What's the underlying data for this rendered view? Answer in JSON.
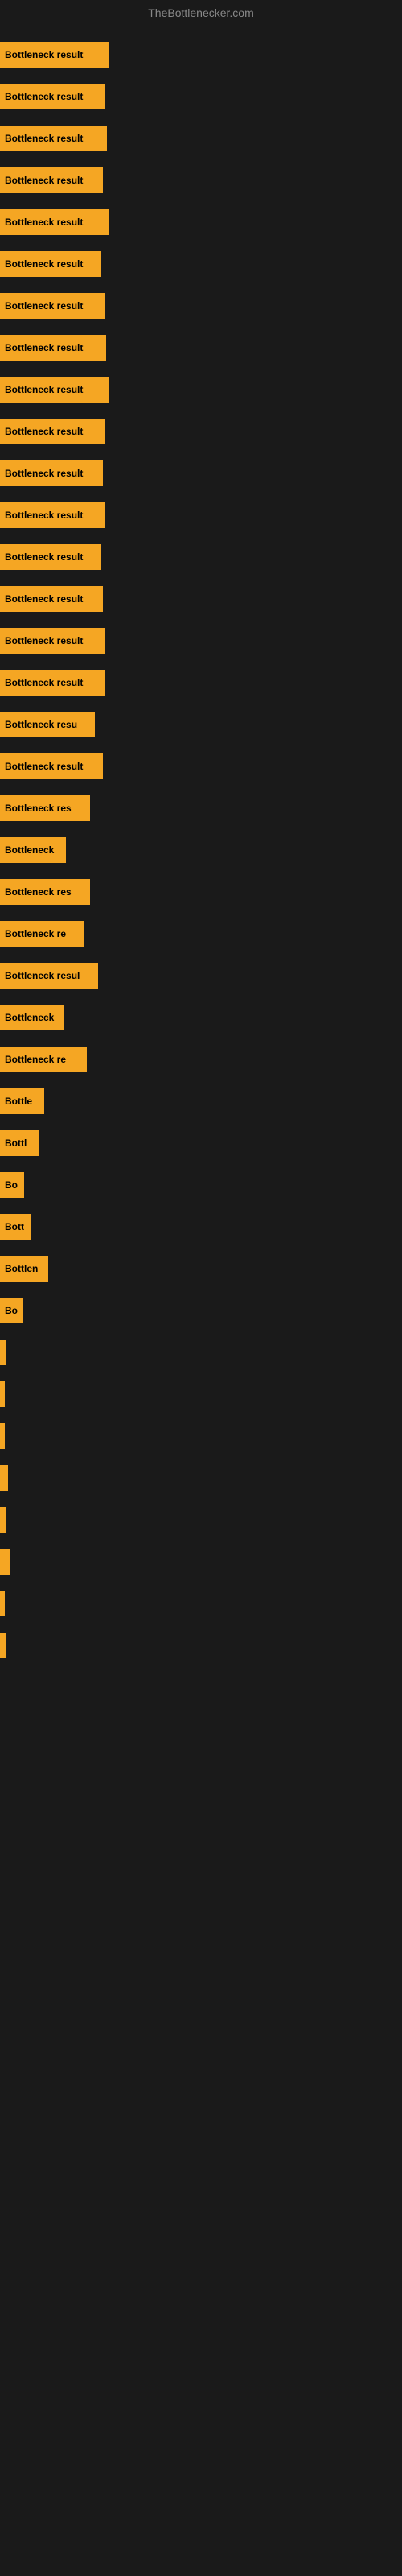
{
  "site_title": "TheBottlenecker.com",
  "bars": [
    {
      "label": "Bottleneck result",
      "width": 135
    },
    {
      "label": "Bottleneck result",
      "width": 130
    },
    {
      "label": "Bottleneck result",
      "width": 133
    },
    {
      "label": "Bottleneck result",
      "width": 128
    },
    {
      "label": "Bottleneck result",
      "width": 135
    },
    {
      "label": "Bottleneck result",
      "width": 125
    },
    {
      "label": "Bottleneck result",
      "width": 130
    },
    {
      "label": "Bottleneck result",
      "width": 132
    },
    {
      "label": "Bottleneck result",
      "width": 135
    },
    {
      "label": "Bottleneck result",
      "width": 130
    },
    {
      "label": "Bottleneck result",
      "width": 128
    },
    {
      "label": "Bottleneck result",
      "width": 130
    },
    {
      "label": "Bottleneck result",
      "width": 125
    },
    {
      "label": "Bottleneck result",
      "width": 128
    },
    {
      "label": "Bottleneck result",
      "width": 130
    },
    {
      "label": "Bottleneck result",
      "width": 130
    },
    {
      "label": "Bottleneck resu",
      "width": 118
    },
    {
      "label": "Bottleneck result",
      "width": 128
    },
    {
      "label": "Bottleneck res",
      "width": 112
    },
    {
      "label": "Bottleneck",
      "width": 82
    },
    {
      "label": "Bottleneck res",
      "width": 112
    },
    {
      "label": "Bottleneck re",
      "width": 105
    },
    {
      "label": "Bottleneck resul",
      "width": 122
    },
    {
      "label": "Bottleneck",
      "width": 80
    },
    {
      "label": "Bottleneck re",
      "width": 108
    },
    {
      "label": "Bottle",
      "width": 55
    },
    {
      "label": "Bottl",
      "width": 48
    },
    {
      "label": "Bo",
      "width": 30
    },
    {
      "label": "Bott",
      "width": 38
    },
    {
      "label": "Bottlen",
      "width": 60
    },
    {
      "label": "Bo",
      "width": 28
    },
    {
      "label": "",
      "width": 8
    },
    {
      "label": "",
      "width": 6
    },
    {
      "label": "",
      "width": 4
    },
    {
      "label": "",
      "width": 10
    },
    {
      "label": "",
      "width": 8
    },
    {
      "label": "",
      "width": 12
    },
    {
      "label": "",
      "width": 6
    },
    {
      "label": "",
      "width": 8
    }
  ]
}
